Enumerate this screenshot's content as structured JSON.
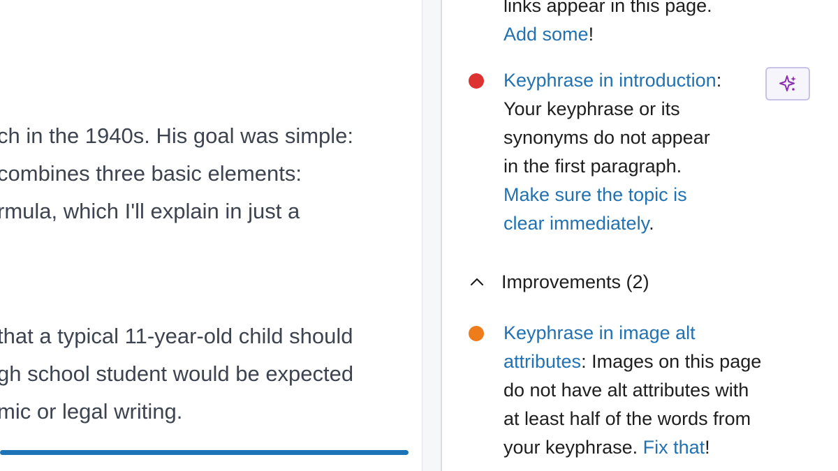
{
  "editor": {
    "paragraph1": [
      "ch in the 1940s. His goal was simple:",
      " combines three basic elements:",
      "rmula, which I'll explain in just a"
    ],
    "paragraph2": [
      "that a typical 11-year-old child should",
      "gh school student would be expected",
      "mic or legal writing."
    ]
  },
  "sidebar": {
    "top_item": {
      "text_line": "links appear in this page.",
      "link": "Add some",
      "link_suffix": "!"
    },
    "problem_item": {
      "status_color": "#dc3232",
      "title": "Keyphrase in introduction",
      "title_suffix": ":",
      "lines": [
        "Your keyphrase or its",
        "synonyms do not appear",
        "in the first paragraph."
      ],
      "link_lines": [
        "Make sure the topic is",
        "clear immediately"
      ],
      "link_suffix": ".",
      "ai_icon": "sparkle-icon"
    },
    "improvements_header": {
      "icon": "chevron-up-icon",
      "label": "Improvements (2)"
    },
    "improvement_item": {
      "status_color": "#ee7c1b",
      "title_line1": "Keyphrase in image alt",
      "title_line2": "attributes",
      "title_suffix": ":",
      "text_after_title": " Images on this page",
      "lines": [
        "do not have alt attributes with",
        "at least half of the words from"
      ],
      "last_line_text": "your keyphrase. ",
      "link": "Fix that",
      "link_suffix": "!"
    }
  },
  "colors": {
    "link": "#2271b1",
    "progress": "#1c73b5",
    "problem": "#dc3232",
    "improvement": "#ee7c1b"
  }
}
